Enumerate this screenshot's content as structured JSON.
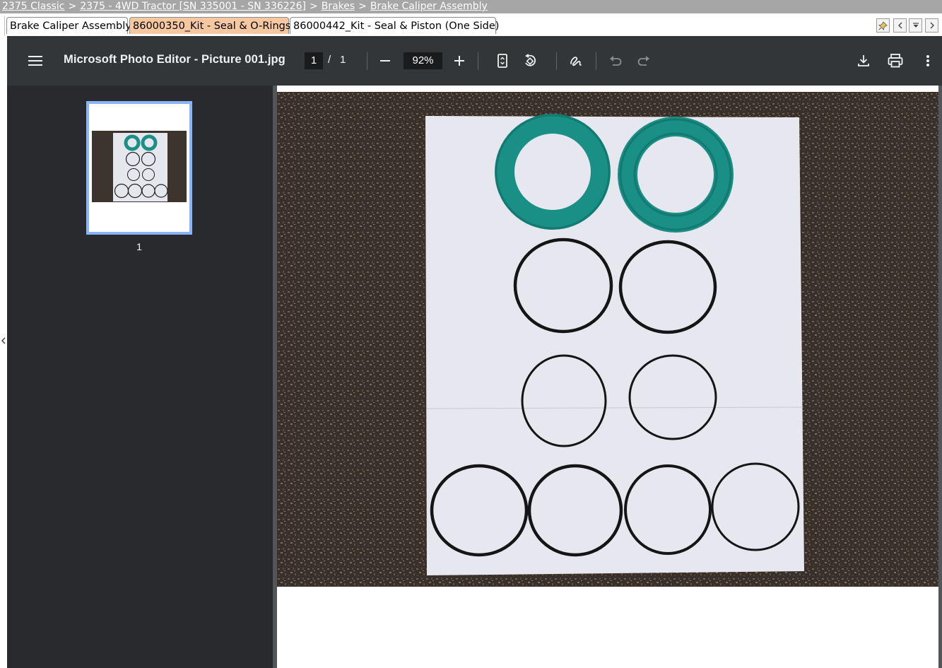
{
  "breadcrumb": {
    "items": [
      "2375 Classic",
      "2375 - 4WD Tractor [SN 335001 - SN 336226]",
      "Brakes",
      "Brake Caliper Assembly"
    ],
    "separator": ">"
  },
  "tabs": [
    {
      "label": "Brake Caliper Assembly",
      "active": false
    },
    {
      "label": "86000350_Kit - Seal & O-Rings",
      "active": true
    },
    {
      "label": "86000442_Kit - Seal & Piston (One Side)",
      "active": false
    }
  ],
  "tab_nav_icons": [
    "pin-icon",
    "chevron-left-icon",
    "dropdown-icon",
    "chevron-right-icon"
  ],
  "viewer": {
    "title": "Microsoft Photo Editor - Picture 001.jpg",
    "page_current": "1",
    "page_separator": "/",
    "page_total": "1",
    "zoom": "92%",
    "toolbar_icons": [
      "menu-icon",
      "zoom-out-icon",
      "zoom-in-icon",
      "fit-page-icon",
      "rotate-icon",
      "annotate-icon",
      "undo-icon",
      "redo-icon",
      "download-icon",
      "print-icon",
      "more-options-icon"
    ],
    "thumbnail_label": "1"
  },
  "colors": {
    "breadcrumb_bg": "#a6a6a6",
    "active_tab": "#f6c8a2",
    "toolbar_bg": "#323639",
    "sidebar_bg": "#282a2d",
    "thumbnail_border": "#8ab4f8",
    "seal_green": "#1a8f86"
  }
}
